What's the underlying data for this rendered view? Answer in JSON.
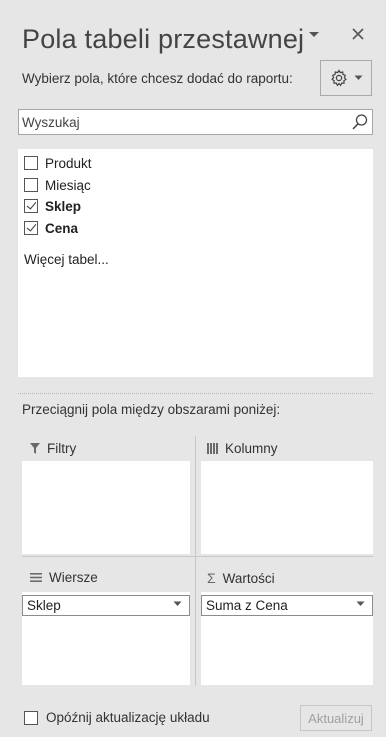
{
  "pane": {
    "title": "Pola tabeli przestawnej",
    "subtitle": "Wybierz pola, które chcesz dodać do raportu:",
    "icons": {
      "dropdown": "chevron-down-icon",
      "close": "close-icon",
      "tools": "gear-icon",
      "search": "search-icon"
    }
  },
  "search": {
    "placeholder": "Wyszukaj",
    "value": ""
  },
  "fields": [
    {
      "label": "Produkt",
      "checked": false
    },
    {
      "label": "Miesiąc",
      "checked": false
    },
    {
      "label": "Sklep",
      "checked": true
    },
    {
      "label": "Cena",
      "checked": true
    }
  ],
  "more_tables": "Więcej tabel...",
  "drag_hint": "Przeciągnij pola między obszarami poniżej:",
  "areas": {
    "filters": {
      "label": "Filtry",
      "icon": "filter-icon",
      "items": []
    },
    "columns": {
      "label": "Kolumny",
      "icon": "columns-icon",
      "items": []
    },
    "rows": {
      "label": "Wiersze",
      "icon": "rows-icon",
      "items": [
        "Sklep"
      ]
    },
    "values": {
      "label": "Wartości",
      "icon": "sigma-icon",
      "items": [
        "Suma z Cena"
      ]
    }
  },
  "footer": {
    "defer_label": "Opóźnij aktualizację układu",
    "defer_checked": false,
    "update_label": "Aktualizuj"
  },
  "colors": {
    "pane_bg": "#e6e6e6",
    "box_bg": "#ffffff",
    "text": "#262626",
    "disabled_text": "#a0a0a0"
  }
}
